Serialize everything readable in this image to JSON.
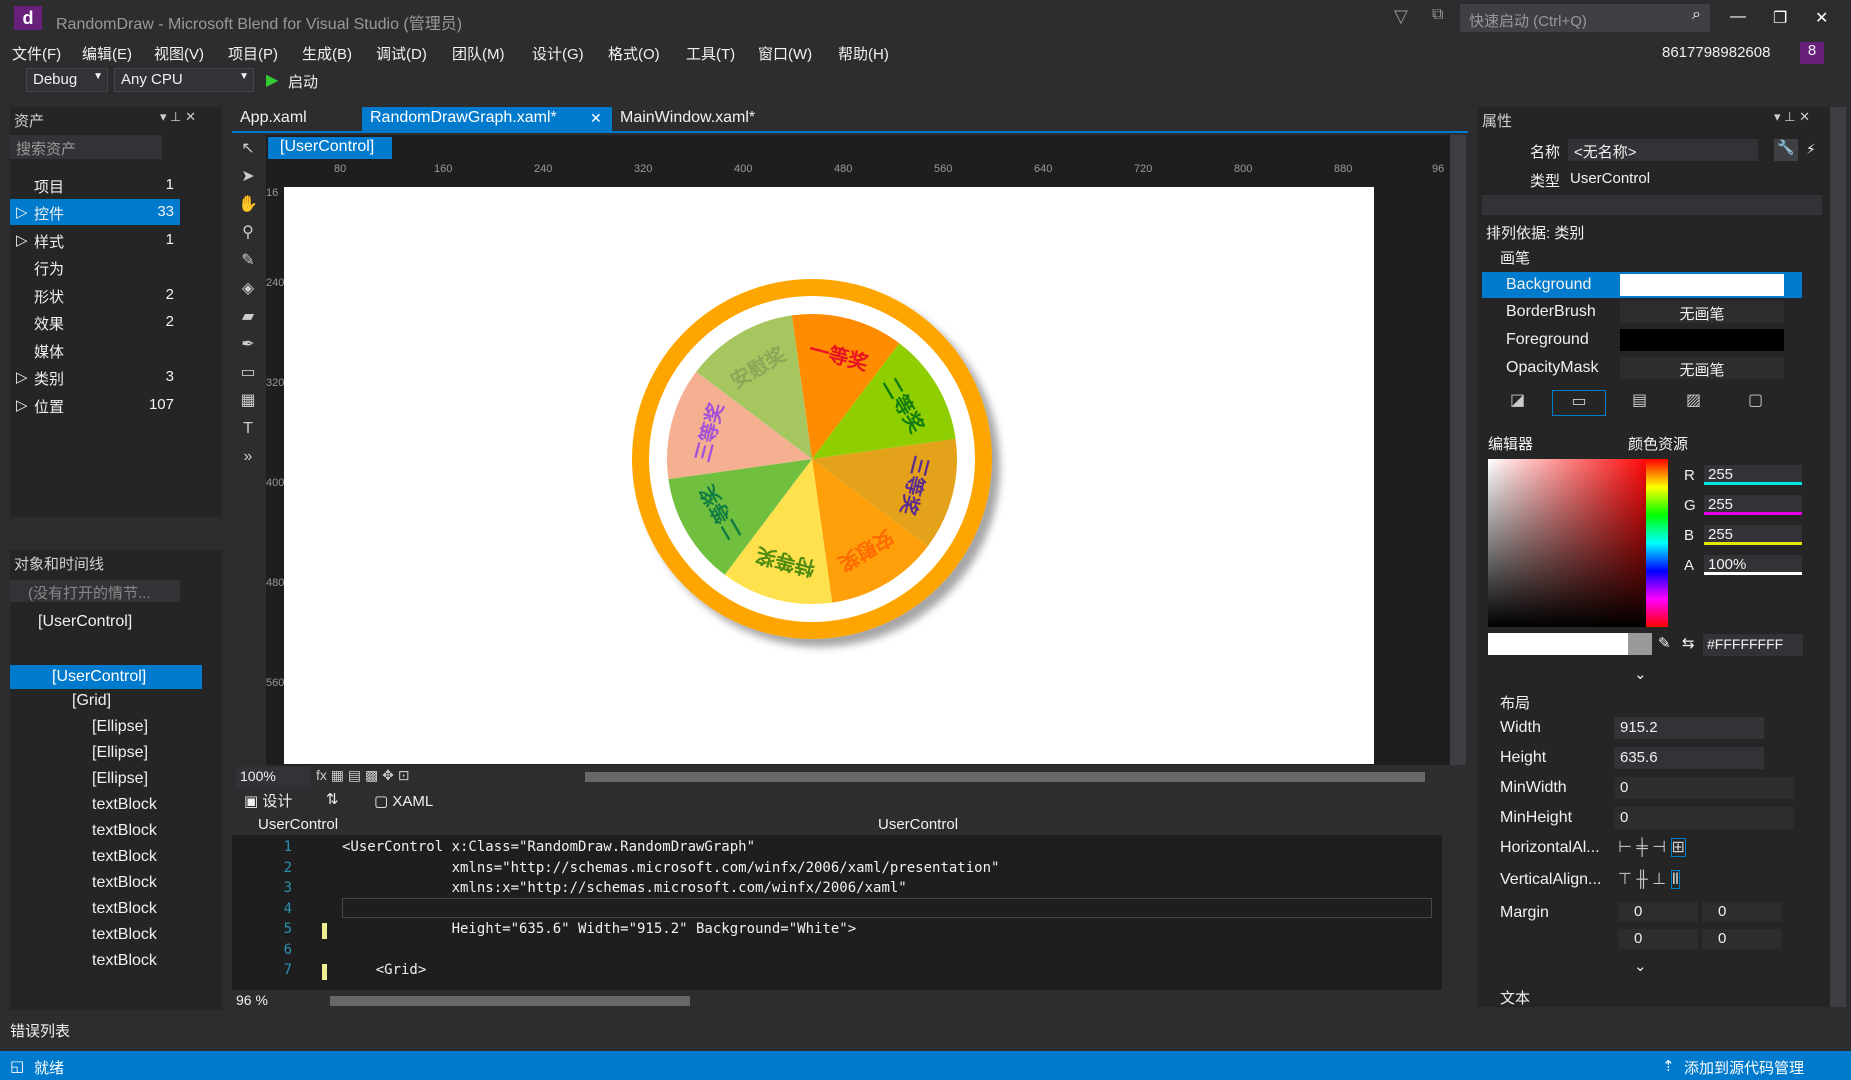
{
  "window": {
    "title": "RandomDraw - Microsoft Blend for Visual Studio (管理员)",
    "quick_launch_placeholder": "快速启动 (Ctrl+Q)",
    "account": "8617798982608",
    "notification_count": "8"
  },
  "menu": [
    "文件(F)",
    "编辑(E)",
    "视图(V)",
    "项目(P)",
    "生成(B)",
    "调试(D)",
    "团队(M)",
    "设计(G)",
    "格式(O)",
    "工具(T)",
    "窗口(W)",
    "帮助(H)"
  ],
  "toolbar": {
    "config": "Debug",
    "platform": "Any CPU",
    "start": "启动"
  },
  "assets": {
    "header": "资产",
    "search_placeholder": "搜索资产",
    "items": [
      {
        "label": "项目",
        "count": "1"
      },
      {
        "label": "控件",
        "count": "33"
      },
      {
        "label": "样式",
        "count": "1"
      },
      {
        "label": "行为",
        "count": ""
      },
      {
        "label": "形状",
        "count": "2"
      },
      {
        "label": "效果",
        "count": "2"
      },
      {
        "label": "媒体",
        "count": ""
      },
      {
        "label": "类别",
        "count": "3"
      },
      {
        "label": "位置",
        "count": "107"
      }
    ]
  },
  "objects": {
    "header": "对象和时间线",
    "storyboard": "(没有打开的情节...",
    "root": "[UserControl]",
    "tree": [
      "[UserControl]",
      "[Grid]",
      "[Ellipse]",
      "[Ellipse]",
      "[Ellipse]",
      "textBlock",
      "textBlock",
      "textBlock",
      "textBlock",
      "textBlock",
      "textBlock",
      "textBlock"
    ]
  },
  "tabs": [
    "App.xaml",
    "RandomDrawGraph.xaml*",
    "MainWindow.xaml*"
  ],
  "breadcrumb": "[UserControl]",
  "ruler_top": [
    "80",
    "160",
    "240",
    "320",
    "400",
    "480",
    "560",
    "640",
    "720",
    "800",
    "880",
    "96"
  ],
  "ruler_left": [
    "16",
    "240",
    "320",
    "400",
    "480",
    "560"
  ],
  "wheel": {
    "segments": [
      {
        "label": "一等奖",
        "color": "#ff8c00",
        "text_color": "#e81123"
      },
      {
        "label": "二等奖",
        "color": "#8fce00",
        "text_color": "#107c10"
      },
      {
        "label": "三等奖",
        "color": "#e3a21a",
        "text_color": "#5b2d90"
      },
      {
        "label": "安慰奖",
        "color": "#ff9f0a",
        "text_color": "#ff6a00"
      },
      {
        "label": "特等奖",
        "color": "#ffe14d",
        "text_color": "#4f8a10"
      },
      {
        "label": "二等奖",
        "color": "#70bf3f",
        "text_color": "#107c41"
      },
      {
        "label": "三等奖",
        "color": "#f4b090",
        "text_color": "#a452d8"
      },
      {
        "label": "安慰奖",
        "color": "#a6c660",
        "text_color": "#8aa858"
      }
    ]
  },
  "zoom_designer": "100%",
  "view_tabs": {
    "design": "设计",
    "xaml": "XAML"
  },
  "code_nav": {
    "left": "UserControl",
    "right": "UserControl"
  },
  "code_lines": [
    {
      "n": "1",
      "text": "<UserControl x:Class=\"RandomDraw.RandomDrawGraph\""
    },
    {
      "n": "2",
      "text": "             xmlns=\"http://schemas.microsoft.com/winfx/2006/xaml/presentation\""
    },
    {
      "n": "3",
      "text": "             xmlns:x=\"http://schemas.microsoft.com/winfx/2006/xaml\""
    },
    {
      "n": "4",
      "text": ""
    },
    {
      "n": "5",
      "text": "             Height=\"635.6\" Width=\"915.2\" Background=\"White\">"
    },
    {
      "n": "6",
      "text": ""
    },
    {
      "n": "7",
      "text": "    <Grid>"
    }
  ],
  "zoom_code": "96 %",
  "errors": "错误列表",
  "properties": {
    "header": "属性",
    "name_label": "名称",
    "name_value": "<无名称>",
    "type_label": "类型",
    "type_value": "UserControl",
    "sort": "排列依据: 类别",
    "brush_section": "画笔",
    "brushes": [
      {
        "name": "Background",
        "value": ""
      },
      {
        "name": "BorderBrush",
        "value": "无画笔"
      },
      {
        "name": "Foreground",
        "value": ""
      },
      {
        "name": "OpacityMask",
        "value": "无画笔"
      }
    ],
    "editor_label": "编辑器",
    "color_resources": "颜色资源",
    "r": "255",
    "g": "255",
    "b": "255",
    "a": "100%",
    "hex": "#FFFFFFFF",
    "layout_section": "布局",
    "layout": [
      {
        "name": "Width",
        "value": "915.2"
      },
      {
        "name": "Height",
        "value": "635.6"
      },
      {
        "name": "MinWidth",
        "value": "0"
      },
      {
        "name": "MinHeight",
        "value": "0"
      }
    ],
    "halign": "HorizontalAl...",
    "valign": "VerticalAlign...",
    "margin": "Margin",
    "margins": [
      "0",
      "0",
      "0",
      "0"
    ],
    "text_section": "文本"
  },
  "status": {
    "left": "就绪",
    "right": "添加到源代码管理"
  }
}
